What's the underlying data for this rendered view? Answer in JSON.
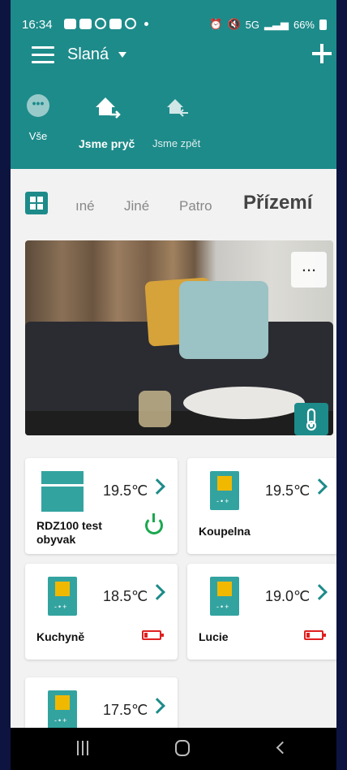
{
  "statusbar": {
    "time": "16:34",
    "battery": "66%",
    "net": "5G"
  },
  "header": {
    "location": "Slaná",
    "modes": [
      {
        "label": "Vše"
      },
      {
        "label": "Jsme pryč"
      },
      {
        "label": "Jsme zpět"
      }
    ]
  },
  "tabs": [
    "ıné",
    "Jiné",
    "Patro",
    "Přízemí"
  ],
  "hero": {
    "more_label": "..."
  },
  "devices": [
    {
      "name": "RDZ100 test obyvak",
      "temp": "19.5℃",
      "status": "power"
    },
    {
      "name": "Koupelna",
      "temp": "19.5℃",
      "status": ""
    },
    {
      "name": "Kuchyně",
      "temp": "18.5℃",
      "status": "low-battery"
    },
    {
      "name": "Lucie",
      "temp": "19.0℃",
      "status": "low-battery"
    },
    {
      "name": "",
      "temp": "17.5℃",
      "status": ""
    }
  ],
  "colors": {
    "primary": "#1d8b8a",
    "device": "#33a3a0",
    "display": "#f1b800",
    "battery_low": "#e02020",
    "power": "#1aa84f"
  }
}
